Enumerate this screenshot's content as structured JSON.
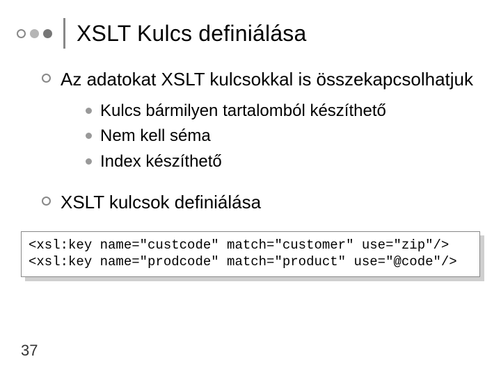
{
  "title": "XSLT Kulcs definiálása",
  "points": {
    "p1": "Az adatokat  XSLT kulcsokkal is összekapcsolhatjuk",
    "sub1": "Kulcs bármilyen tartalomból készíthető",
    "sub2": "Nem kell séma",
    "sub3": "Index készíthető",
    "p2": "XSLT kulcsok definiálása"
  },
  "code": {
    "line1": "<xsl:key name=\"custcode\" match=\"customer\" use=\"zip\"/>",
    "line2": "<xsl:key name=\"prodcode\" match=\"product\" use=\"@code\"/>"
  },
  "page": "37"
}
